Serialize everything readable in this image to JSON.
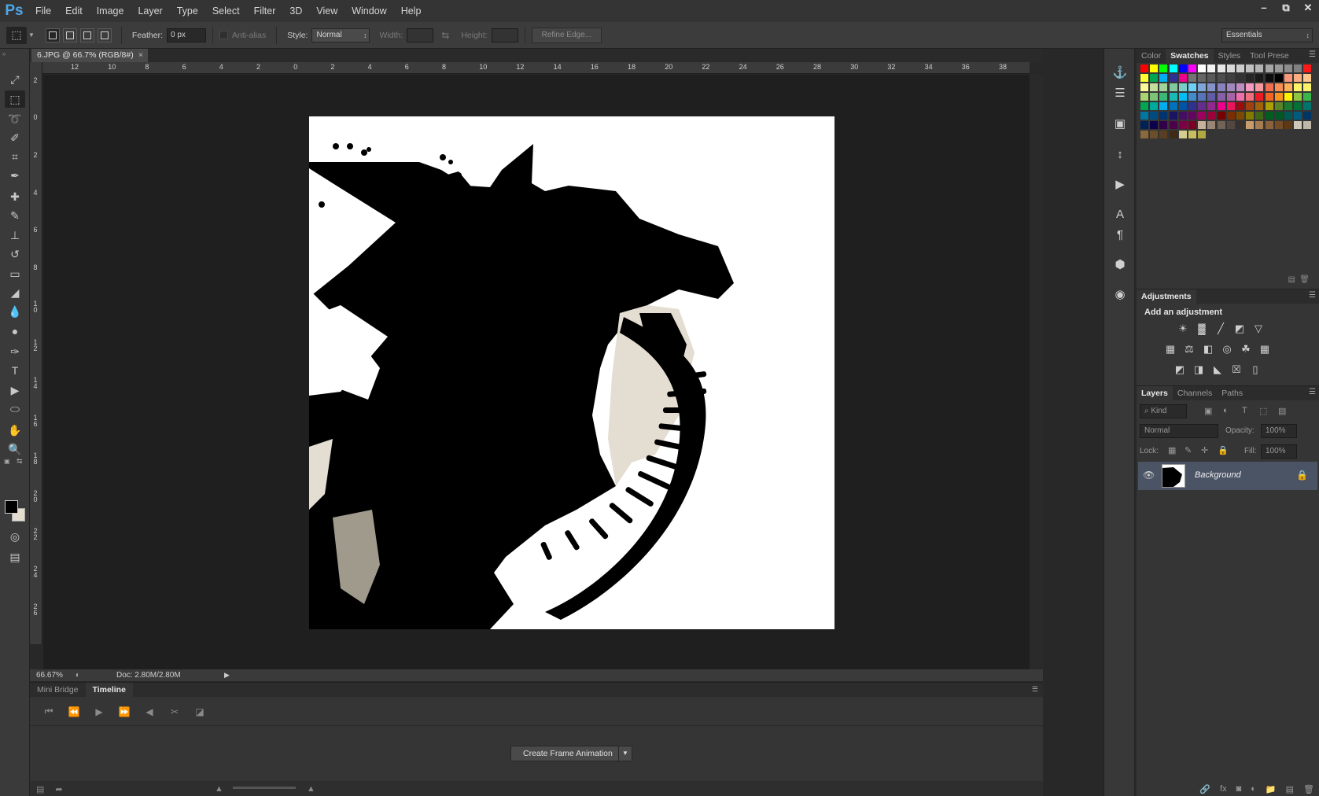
{
  "app": {
    "logo": "Ps"
  },
  "menu": [
    "File",
    "Edit",
    "Image",
    "Layer",
    "Type",
    "Select",
    "Filter",
    "3D",
    "View",
    "Window",
    "Help"
  ],
  "window_controls": {
    "minimize": "–",
    "restore": "⧉",
    "close": "✕"
  },
  "options": {
    "feather_label": "Feather:",
    "feather_value": "0 px",
    "antialias_label": "Anti-alias",
    "style_label": "Style:",
    "style_value": "Normal",
    "width_label": "Width:",
    "height_label": "Height:",
    "refine_edge": "Refine Edge...",
    "workspace": "Essentials"
  },
  "document": {
    "tab_title": "6.JPG @ 66.7% (RGB/8#)",
    "close": "×"
  },
  "ruler_h": [
    "12",
    "10",
    "8",
    "6",
    "4",
    "2",
    "0",
    "2",
    "4",
    "6",
    "8",
    "10",
    "12",
    "14",
    "16",
    "18",
    "20",
    "22",
    "24",
    "26",
    "28",
    "30",
    "32",
    "34",
    "36",
    "38"
  ],
  "ruler_v": [
    "2",
    "0",
    "2",
    "4",
    "6",
    "8",
    "10",
    "12",
    "14",
    "16",
    "18",
    "20",
    "22",
    "24",
    "26"
  ],
  "status": {
    "zoom": "66.67%",
    "doc": "Doc: 2.80M/2.80M"
  },
  "timeline": {
    "tabs": [
      "Mini Bridge",
      "Timeline"
    ],
    "create_button": "Create Frame Animation"
  },
  "panels": {
    "color_tabs": [
      "Color",
      "Swatches",
      "Styles",
      "Tool Prese"
    ],
    "adjustments_title": "Adjustments",
    "adjustments_subtitle": "Add an adjustment",
    "layers_tabs": [
      "Layers",
      "Channels",
      "Paths"
    ],
    "kind_label": "Kind",
    "blend_mode": "Normal",
    "opacity_label": "Opacity:",
    "opacity_value": "100%",
    "lock_label": "Lock:",
    "fill_label": "Fill:",
    "fill_value": "100%",
    "layer_name": "Background"
  },
  "swatch_rows": [
    [
      "#ff0000",
      "#ffff00",
      "#00ff00",
      "#00ffff",
      "#0000ff",
      "#ff00ff",
      "#ffffff",
      "#f2f2f2",
      "#e6e6e6",
      "#d9d9d9",
      "#cccccc",
      "#bfbfbf",
      "#b3b3b3",
      "#a6a6a6",
      "#999999",
      "#8c8c8c",
      "#808080",
      "#ff1a1a"
    ],
    [
      "#ffff33",
      "#00a651",
      "#00aeef",
      "#2e3192",
      "#ec008c",
      "#737373",
      "#666666",
      "#595959",
      "#4d4d4d",
      "#404040",
      "#333333",
      "#262626",
      "#1a1a1a",
      "#0d0d0d",
      "#000000",
      "#f7977a",
      "#f9ad81",
      "#fdc68a"
    ],
    [
      "#fff79a",
      "#c4df9b",
      "#a3d39c",
      "#82ca9d",
      "#7bcdc8",
      "#6ecff6",
      "#7ea7d8",
      "#8493ca",
      "#8882be",
      "#a187be",
      "#bc8dbf",
      "#f49ac2",
      "#f6989d",
      "#f26c4f",
      "#f68e55",
      "#fbaf5c",
      "#fff467",
      "#f7f26a"
    ],
    [
      "#acd372",
      "#7cc576",
      "#3bb878",
      "#1abbb4",
      "#00bff3",
      "#438ccb",
      "#5574b9",
      "#605ca8",
      "#855fa8",
      "#a763a8",
      "#f06eaa",
      "#f26d7d",
      "#ed1c24",
      "#f26522",
      "#f7941d",
      "#fff200",
      "#8dc73f",
      "#39b54a"
    ],
    [
      "#00a651",
      "#00a99d",
      "#00aeef",
      "#0072bc",
      "#0054a6",
      "#2e3192",
      "#662d91",
      "#92278f",
      "#ec008c",
      "#ed145b",
      "#9e0b0f",
      "#a0410d",
      "#a36209",
      "#aba000",
      "#598527",
      "#1a7b30",
      "#007236",
      "#00746b"
    ],
    [
      "#0076a3",
      "#004b80",
      "#003471",
      "#1b1464",
      "#440e62",
      "#630460",
      "#9e005d",
      "#9e0039",
      "#790000",
      "#7b2e00",
      "#7d4900",
      "#827b00",
      "#406618",
      "#005e20",
      "#005826",
      "#005952",
      "#005b7f",
      "#003663"
    ],
    [
      "#002157",
      "#0d004c",
      "#32004b",
      "#4b0049",
      "#7b0046",
      "#7a0026",
      "#c7b299",
      "#998675",
      "#736357",
      "#534741",
      "#37302d",
      "#c69c6d",
      "#a67c52",
      "#8c6239",
      "#754c24",
      "#603913",
      "#cfc8b8",
      "#bfb8a8"
    ],
    [
      "#8a6a3c",
      "#6b4f2a",
      "#5a3e22",
      "#3e2a16",
      "#d4cc90",
      "#c8c060",
      "#b0a840"
    ]
  ]
}
